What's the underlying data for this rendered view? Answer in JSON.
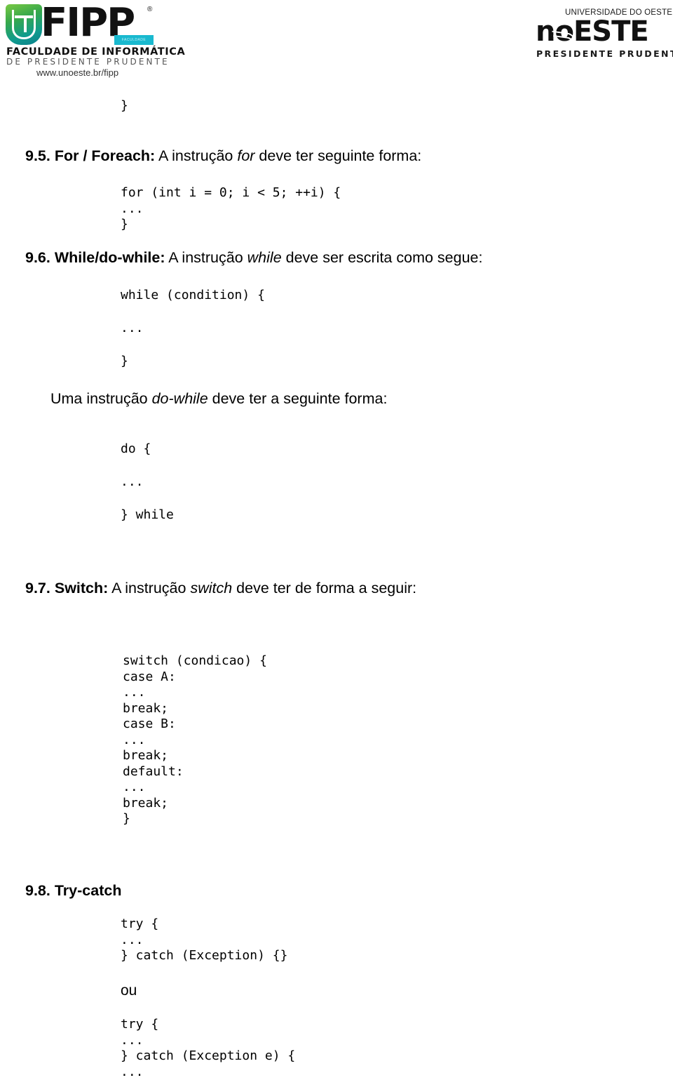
{
  "header": {
    "left_logo": {
      "name": "FIPP",
      "wordmark": "FIPP",
      "registered_mark": "®",
      "teal_tag": "FACULDADE",
      "line2": "FACULDADE DE INFORMÁTICA",
      "line3": "DE PRESIDENTE PRUDENTE",
      "url": "www.unoeste.br/fipp"
    },
    "right_logo": {
      "name": "UNOESTE",
      "top_line": "UNIVERSIDADE DO OESTE PAULISTA",
      "wordmark": "noESTE",
      "bottom_line": "PRESIDENTE  PRUDENTE - SP"
    }
  },
  "document": {
    "top_fragment": "}",
    "sections": [
      {
        "id": "9.5",
        "number": "9.5.",
        "keyword": "For / Foreach:",
        "text_before": " A instrução ",
        "italic": "for",
        "text_after": " deve ter seguinte forma:",
        "code": "for (int i = 0; i < 5; ++i) {\n...\n}"
      },
      {
        "id": "9.6",
        "number": "9.6.",
        "keyword": "While/do-while:",
        "text_before": " A instrução ",
        "italic": "while",
        "text_after": " deve ser escrita como segue:",
        "code_lines": [
          "while (condition) {",
          "...",
          "}"
        ],
        "paragraph": {
          "before": "Uma instrução ",
          "italic": "do-while",
          "after": " deve ter a seguinte forma:"
        },
        "code_lines_2": [
          "do {",
          "...",
          "} while"
        ]
      },
      {
        "id": "9.7",
        "number": "9.7.",
        "keyword": "Switch:",
        "text_before": " A instrução ",
        "italic": "switch",
        "text_after": " deve ter de forma a seguir:",
        "code": "switch (condicao) {\ncase A:\n...\nbreak;\ncase B:\n...\nbreak;\ndefault:\n...\nbreak;\n}"
      },
      {
        "id": "9.8",
        "number": "9.8.",
        "keyword": "Try-catch",
        "text_before": "",
        "italic": "",
        "text_after": "",
        "code_block_1": "try {\n...\n} catch (Exception) {}",
        "separator": "ou",
        "code_block_2": "try {\n...\n} catch (Exception e) {\n..."
      }
    ]
  }
}
